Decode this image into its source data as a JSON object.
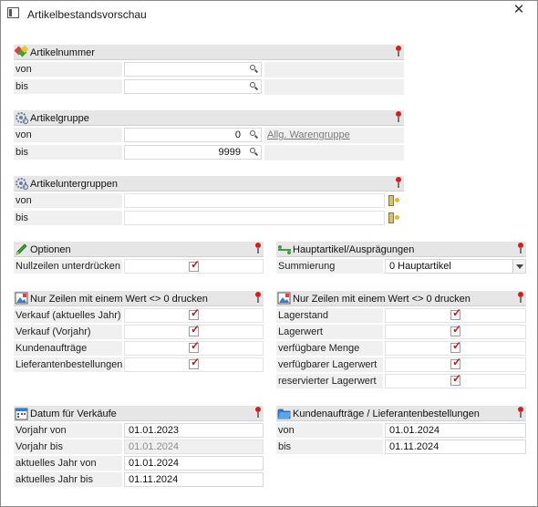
{
  "window": {
    "title": "Artikelbestandsvorschau",
    "close_symbol": "✕"
  },
  "artikelnummer": {
    "title": "Artikelnummer",
    "rows": [
      {
        "label": "von",
        "value": ""
      },
      {
        "label": "bis",
        "value": ""
      }
    ]
  },
  "artikelgruppe": {
    "title": "Artikelgruppe",
    "rows": [
      {
        "label": "von",
        "value": "0"
      },
      {
        "label": "bis",
        "value": "9999"
      }
    ],
    "link": "Allg. Warengruppe"
  },
  "artikeluntergruppen": {
    "title": "Artikeluntergruppen",
    "rows": [
      {
        "label": "von",
        "value": ""
      },
      {
        "label": "bis",
        "value": ""
      }
    ]
  },
  "optionen": {
    "title": "Optionen",
    "rows": [
      {
        "label": "Nullzeilen unterdrücken",
        "checked": true
      }
    ]
  },
  "hauptartikel": {
    "title": "Hauptartikel/Ausprägungen",
    "rows": [
      {
        "label": "Summierung",
        "value": "0 Hauptartikel"
      }
    ]
  },
  "nur_zeilen_left": {
    "title": "Nur Zeilen mit einem Wert <> 0 drucken",
    "rows": [
      {
        "label": "Verkauf (aktuelles Jahr)",
        "checked": true
      },
      {
        "label": "Verkauf (Vorjahr)",
        "checked": true
      },
      {
        "label": "Kundenaufträge",
        "checked": true
      },
      {
        "label": "Lieferantenbestellungen",
        "checked": true
      }
    ]
  },
  "nur_zeilen_right": {
    "title": "Nur Zeilen mit einem Wert <> 0 drucken",
    "rows": [
      {
        "label": "Lagerstand",
        "checked": true
      },
      {
        "label": "Lagerwert",
        "checked": true
      },
      {
        "label": "verfügbare Menge",
        "checked": true
      },
      {
        "label": "verfügbarer Lagerwert",
        "checked": true
      },
      {
        "label": "reservierter Lagerwert",
        "checked": true
      }
    ]
  },
  "datum_verkaeufe": {
    "title": "Datum für Verkäufe",
    "rows": [
      {
        "label": "Vorjahr von",
        "value": "01.01.2023"
      },
      {
        "label": "Vorjahr bis",
        "value": "01.01.2024"
      },
      {
        "label": "aktuelles Jahr von",
        "value": "01.01.2024"
      },
      {
        "label": "aktuelles Jahr bis",
        "value": "01.11.2024"
      }
    ]
  },
  "kundenauftraege": {
    "title": "Kundenaufträge / Lieferantenbestellungen",
    "rows": [
      {
        "label": "von",
        "value": "01.01.2024"
      },
      {
        "label": "bis",
        "value": "01.11.2024"
      }
    ]
  },
  "check_symbol": "✓"
}
